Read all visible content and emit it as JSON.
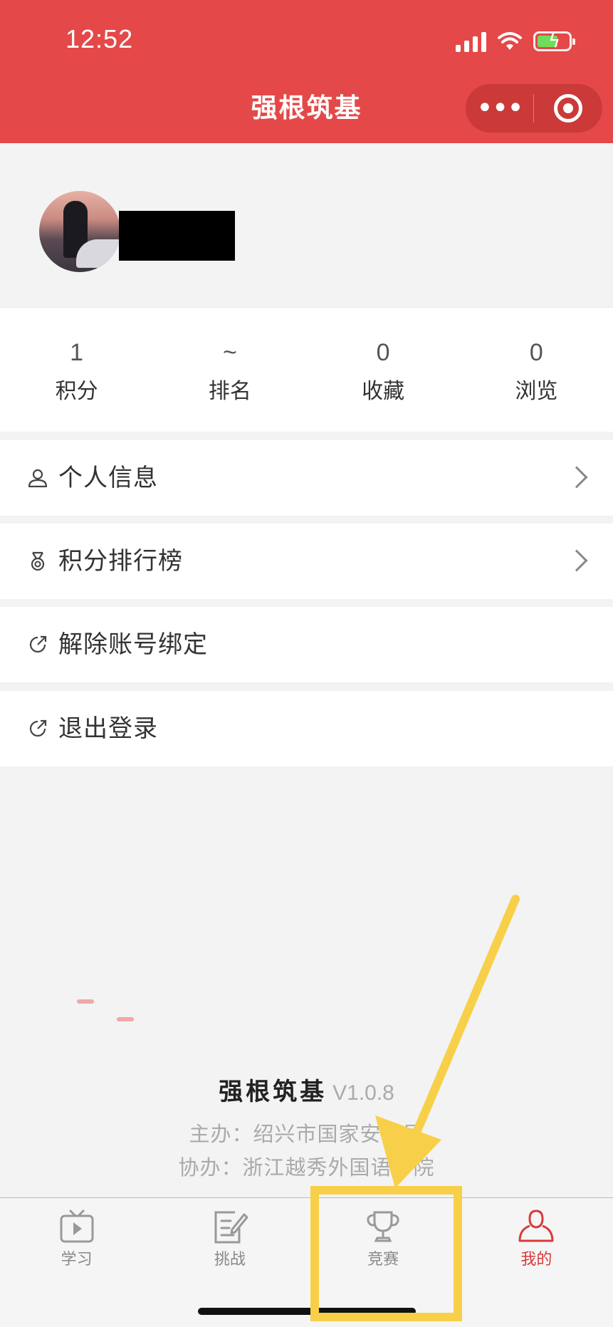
{
  "status_bar": {
    "time": "12:52"
  },
  "header": {
    "title": "强根筑基",
    "capsule_more": "•••"
  },
  "profile": {
    "avatar": "avatar-photo"
  },
  "stats": [
    {
      "value": "1",
      "label": "积分"
    },
    {
      "value": "~",
      "label": "排名"
    },
    {
      "value": "0",
      "label": "收藏"
    },
    {
      "value": "0",
      "label": "浏览"
    }
  ],
  "menu": [
    {
      "label": "个人信息",
      "icon": "user-icon",
      "chevron": true
    },
    {
      "label": "积分排行榜",
      "icon": "medal-icon",
      "chevron": true
    },
    {
      "label": "解除账号绑定",
      "icon": "external-link-icon",
      "chevron": false
    },
    {
      "label": "退出登录",
      "icon": "external-link-icon",
      "chevron": false
    }
  ],
  "footer": {
    "brand": "强根筑基",
    "version": "V1.0.8",
    "host": "主办：绍兴市国家安全局",
    "co_host": "协办：浙江越秀外国语学院"
  },
  "tabbar": [
    {
      "label": "学习",
      "icon": "tv-play-icon",
      "active": false
    },
    {
      "label": "挑战",
      "icon": "edit-note-icon",
      "active": false
    },
    {
      "label": "竞赛",
      "icon": "trophy-icon",
      "active": false
    },
    {
      "label": "我的",
      "icon": "user-icon",
      "active": true
    }
  ],
  "colors": {
    "header_bg": "#e54848",
    "active_tab": "#d93a3a",
    "annotation": "#f8cf48"
  }
}
